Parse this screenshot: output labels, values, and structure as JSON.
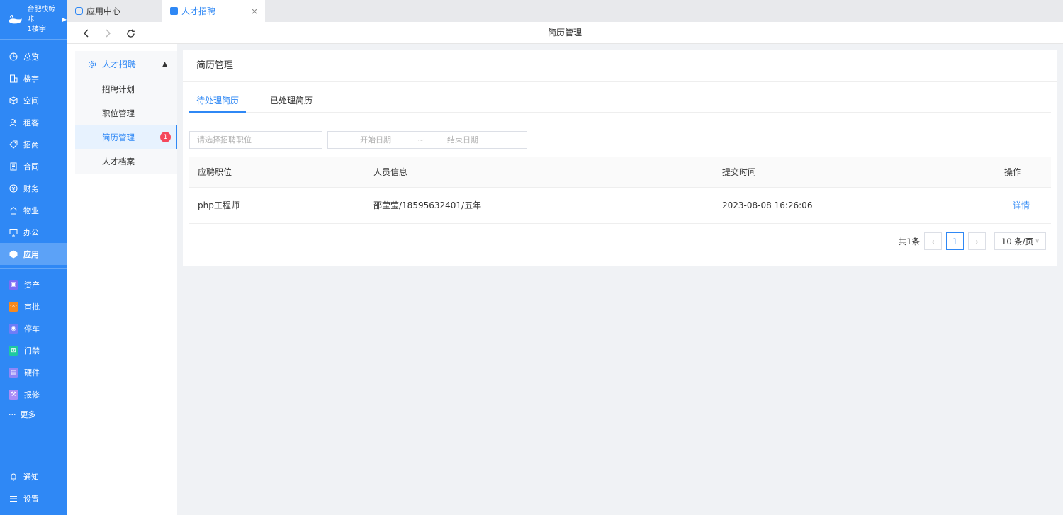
{
  "brand": {
    "line1": "合肥快鲸咔",
    "line2": "1楼宇",
    "arrow": "▶"
  },
  "nav": {
    "items": [
      {
        "label": "总览",
        "icon": "pie-chart-icon"
      },
      {
        "label": "楼宇",
        "icon": "building-icon"
      },
      {
        "label": "空间",
        "icon": "cube-icon"
      },
      {
        "label": "租客",
        "icon": "users-icon"
      },
      {
        "label": "招商",
        "icon": "tag-icon"
      },
      {
        "label": "合同",
        "icon": "document-icon"
      },
      {
        "label": "财务",
        "icon": "money-icon"
      },
      {
        "label": "物业",
        "icon": "home-icon"
      },
      {
        "label": "办公",
        "icon": "monitor-icon"
      },
      {
        "label": "应用",
        "icon": "app-cube-icon",
        "active": true
      }
    ],
    "apps": [
      {
        "label": "资产",
        "icon": "asset-icon",
        "color": "#7b6cf6"
      },
      {
        "label": "审批",
        "icon": "approval-icon",
        "color": "#f7891f"
      },
      {
        "label": "停车",
        "icon": "parking-icon",
        "color": "#6f7cf7"
      },
      {
        "label": "门禁",
        "icon": "access-icon",
        "color": "#1ec9a0"
      },
      {
        "label": "硬件",
        "icon": "hardware-icon",
        "color": "#8f86f7"
      },
      {
        "label": "报修",
        "icon": "repair-icon",
        "color": "#a98cf7"
      }
    ],
    "more": "更多",
    "bottom": [
      {
        "label": "通知",
        "icon": "bell-icon"
      },
      {
        "label": "设置",
        "icon": "menu-icon"
      }
    ]
  },
  "tabs": {
    "app_center": "应用中心",
    "recruit": "人才招聘",
    "close": "×"
  },
  "toolbar": {
    "title": "简历管理",
    "back": "‹",
    "forward": "›",
    "refresh": "↻"
  },
  "submenu": {
    "head": "人才招聘",
    "items": [
      {
        "label": "招聘计划"
      },
      {
        "label": "职位管理"
      },
      {
        "label": "简历管理",
        "badge": "1",
        "active": true
      },
      {
        "label": "人才档案"
      }
    ]
  },
  "main": {
    "title": "简历管理",
    "tabs": [
      "待处理简历",
      "已处理简历"
    ],
    "filter": {
      "position_placeholder": "请选择招聘职位",
      "start": "开始日期",
      "sep": "~",
      "end": "结束日期"
    },
    "columns": [
      "应聘职位",
      "人员信息",
      "提交时间",
      "操作"
    ],
    "rows": [
      {
        "position": "php工程师",
        "info": "邵莹莹/18595632401/五年",
        "time": "2023-08-08 16:26:06",
        "action": "详情"
      }
    ],
    "pager": {
      "total": "共1条",
      "page": "1",
      "size": "10 条/页",
      "prev": "‹",
      "next": "›"
    }
  },
  "colors": {
    "primary": "#2f88f5",
    "badge": "#f5475b"
  }
}
